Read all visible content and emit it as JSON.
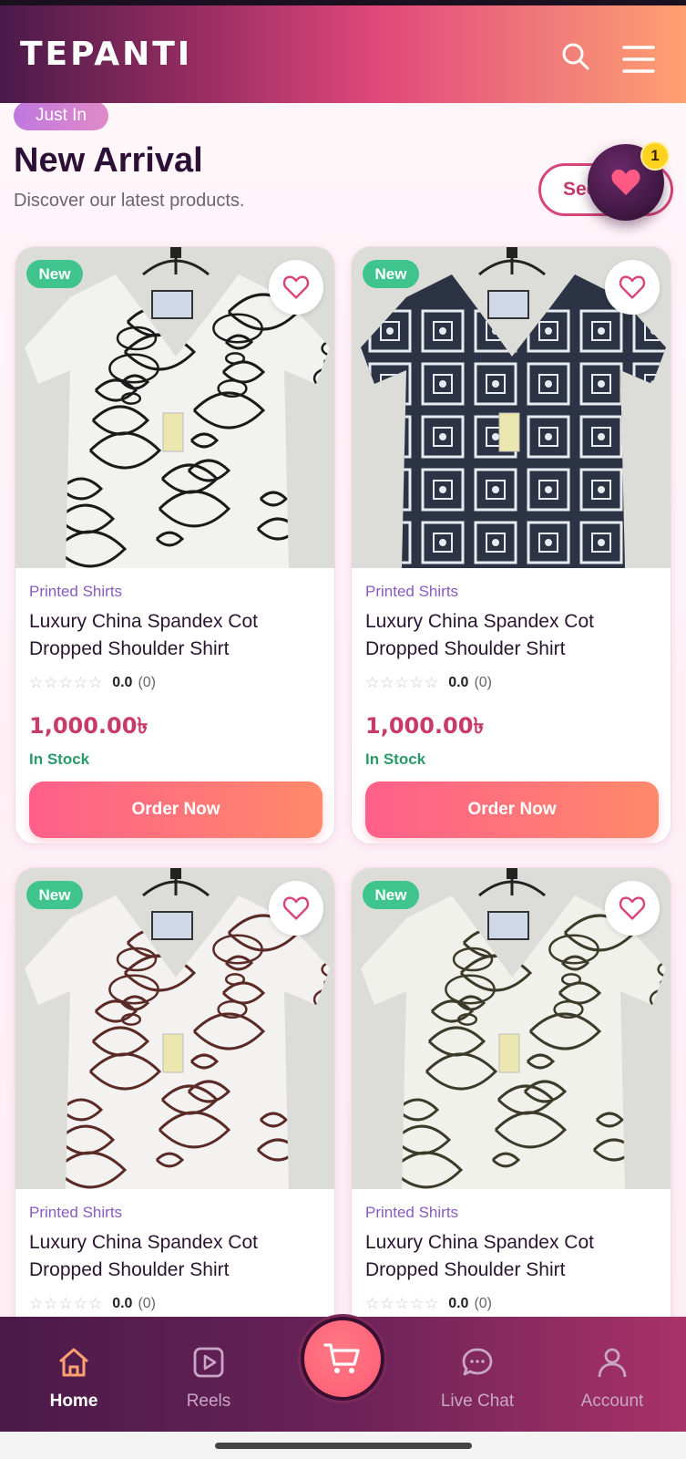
{
  "app": {
    "logo": "TEPANTI"
  },
  "header": {
    "search_icon": "search-icon",
    "menu_icon": "hamburger-menu-icon"
  },
  "section": {
    "badge": "Just In",
    "title": "New Arrival",
    "subtitle": "Discover our latest products.",
    "see_all": "See All",
    "wishlist_count": "1"
  },
  "products": [
    {
      "badge": "New",
      "category": "Printed Shirts",
      "name": "Luxury China Spandex Cot Dropped Shoulder Shirt",
      "stars": "☆☆☆☆☆",
      "rating": "0.0",
      "reviews": "(0)",
      "price": "1,000.00৳",
      "stock": "In Stock",
      "cta": "Order Now",
      "pattern": "white-black-abstract",
      "colors": {
        "base": "#f2f2f0",
        "ink": "#1a1a1a"
      }
    },
    {
      "badge": "New",
      "category": "Printed Shirts",
      "name": "Luxury China Spandex Cot Dropped Shoulder Shirt",
      "stars": "☆☆☆☆☆",
      "rating": "0.0",
      "reviews": "(0)",
      "price": "1,000.00৳",
      "stock": "In Stock",
      "cta": "Order Now",
      "pattern": "navy-bandana",
      "colors": {
        "base": "#2b3344",
        "ink": "#e8ecf0"
      }
    },
    {
      "badge": "New",
      "category": "Printed Shirts",
      "name": "Luxury China Spandex Cot Dropped Shoulder Shirt",
      "stars": "☆☆☆☆☆",
      "rating": "0.0",
      "reviews": "(0)",
      "price": "",
      "stock": "",
      "cta": "",
      "pattern": "white-brown-botanical",
      "colors": {
        "base": "#f4f2f0",
        "ink": "#5a2a26"
      }
    },
    {
      "badge": "New",
      "category": "Printed Shirts",
      "name": "Luxury China Spandex Cot Dropped Shoulder Shirt",
      "stars": "☆☆☆☆☆",
      "rating": "0.0",
      "reviews": "(0)",
      "price": "",
      "stock": "",
      "cta": "",
      "pattern": "white-olive-botanical",
      "colors": {
        "base": "#f1f1ec",
        "ink": "#3c3a28"
      }
    }
  ],
  "bottom_nav": [
    {
      "label": "Home",
      "icon": "home-icon",
      "active": true
    },
    {
      "label": "Reels",
      "icon": "reels-play-icon",
      "active": false
    },
    {
      "label": "",
      "icon": "cart-icon",
      "active": false
    },
    {
      "label": "Live Chat",
      "icon": "chat-bubble-icon",
      "active": false
    },
    {
      "label": "Account",
      "icon": "user-icon",
      "active": false
    }
  ],
  "theme": {
    "primary": "#e0487a",
    "accent": "#ff8a6a",
    "dark": "#4a1a48",
    "success": "#3ec48c"
  }
}
